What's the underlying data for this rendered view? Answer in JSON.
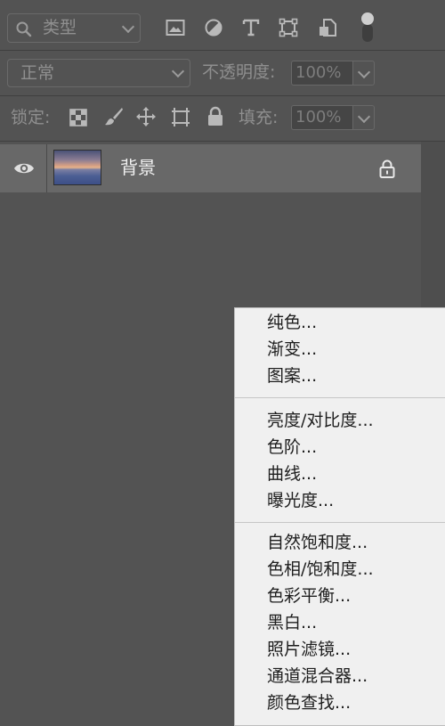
{
  "filter_bar": {
    "kind_label": "类型",
    "filter_icons": [
      "image-filter-icon",
      "adjustment-filter-icon",
      "type-filter-icon",
      "shape-filter-icon",
      "smart-object-filter-icon"
    ],
    "toggle_icon": "filter-toggle-icon"
  },
  "blend_row": {
    "blend_mode": "正常",
    "opacity_label": "不透明度:",
    "opacity_value": "100%"
  },
  "lock_row": {
    "lock_label": "锁定:",
    "lock_icons": [
      "lock-transparent-pixels-icon",
      "lock-image-pixels-icon",
      "lock-position-icon",
      "lock-artboard-icon",
      "lock-all-icon"
    ],
    "fill_label": "填充:",
    "fill_value": "100%"
  },
  "layers": [
    {
      "name": "背景",
      "visible": true,
      "locked": true
    }
  ],
  "adjustment_menu": {
    "groups": [
      [
        "纯色...",
        "渐变...",
        "图案..."
      ],
      [
        "亮度/对比度...",
        "色阶...",
        "曲线...",
        "曝光度..."
      ],
      [
        "自然饱和度...",
        "色相/饱和度...",
        "色彩平衡...",
        "黑白...",
        "照片滤镜...",
        "通道混合器...",
        "颜色查找..."
      ]
    ]
  },
  "colors": {
    "panel_bg": "#535353",
    "selected_layer_bg": "#686868",
    "menu_bg": "#f0f0f0",
    "menu_text": "#1e1e1e"
  }
}
